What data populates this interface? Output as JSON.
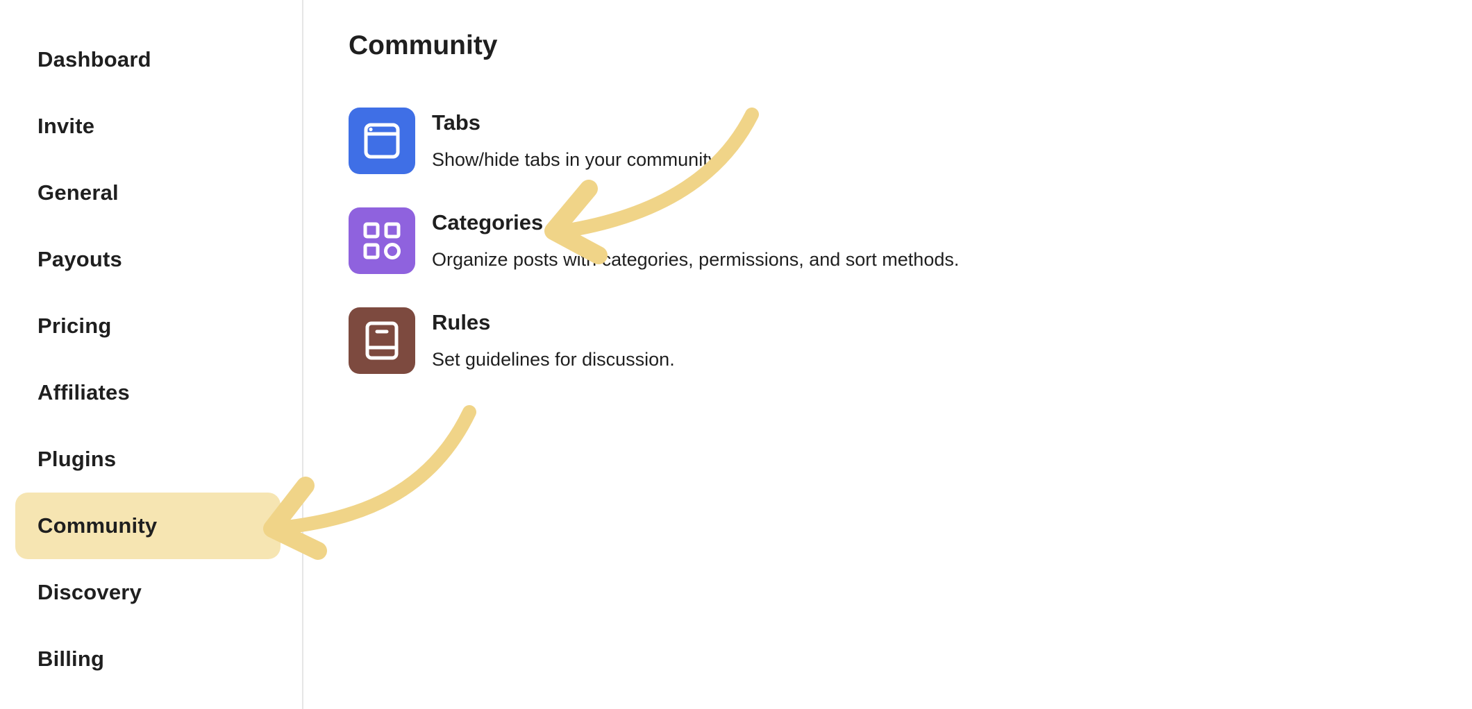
{
  "sidebar": {
    "items": [
      {
        "label": "Dashboard",
        "active": false
      },
      {
        "label": "Invite",
        "active": false
      },
      {
        "label": "General",
        "active": false
      },
      {
        "label": "Payouts",
        "active": false
      },
      {
        "label": "Pricing",
        "active": false
      },
      {
        "label": "Affiliates",
        "active": false
      },
      {
        "label": "Plugins",
        "active": false
      },
      {
        "label": "Community",
        "active": true
      },
      {
        "label": "Discovery",
        "active": false
      },
      {
        "label": "Billing",
        "active": false
      }
    ]
  },
  "main": {
    "title": "Community",
    "settings": [
      {
        "title": "Tabs",
        "description": "Show/hide tabs in your community.",
        "icon": "browser-window-icon",
        "color": "#3f6fe6"
      },
      {
        "title": "Categories",
        "description": "Organize posts with categories, permissions, and sort methods.",
        "icon": "categories-grid-icon",
        "color": "#8f62de"
      },
      {
        "title": "Rules",
        "description": "Set guidelines for discussion.",
        "icon": "book-icon",
        "color": "#7d4a3f"
      }
    ]
  },
  "colors": {
    "active_highlight": "#f6e5b2",
    "annotation_arrow": "#f0d488"
  }
}
